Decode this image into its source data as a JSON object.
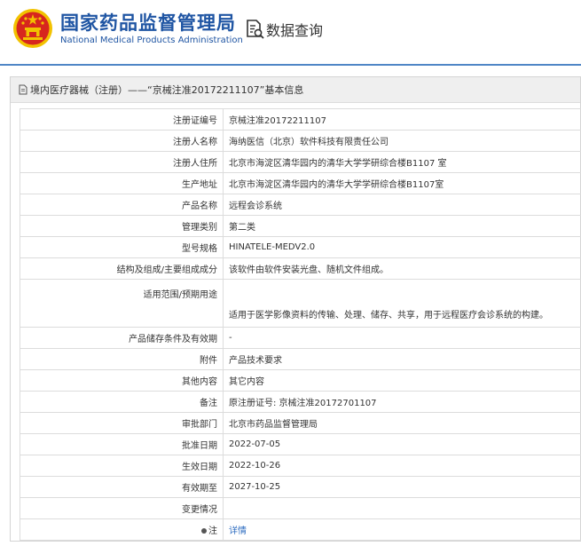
{
  "header": {
    "org_name_cn": "国家药品监督管理局",
    "org_name_en": "National Medical Products Administration",
    "query_title": "数据查询"
  },
  "panel": {
    "title": "境内医疗器械（注册）——“京械注准20172211107”基本信息"
  },
  "rows": [
    {
      "label": "注册证编号",
      "value": "京械注准20172211107"
    },
    {
      "label": "注册人名称",
      "value": "海纳医信（北京）软件科技有限责任公司"
    },
    {
      "label": "注册人住所",
      "value": "北京市海淀区清华园内的清华大学学研综合楼B1107 室"
    },
    {
      "label": "生产地址",
      "value": "北京市海淀区清华园内的清华大学学研综合楼B1107室"
    },
    {
      "label": "产品名称",
      "value": "远程会诊系统"
    },
    {
      "label": "管理类别",
      "value": "第二类"
    },
    {
      "label": "型号规格",
      "value": "HINATELE-MEDV2.0"
    },
    {
      "label": "结构及组成/主要组成成分",
      "value": "该软件由软件安装光盘、随机文件组成。"
    },
    {
      "label": "适用范围/预期用途",
      "value": "适用于医学影像资料的传输、处理、储存、共享，用于远程医疗会诊系统的构建。"
    },
    {
      "label": "产品储存条件及有效期",
      "value": "-"
    },
    {
      "label": "附件",
      "value": "产品技术要求"
    },
    {
      "label": "其他内容",
      "value": "其它内容"
    },
    {
      "label": "备注",
      "value": "原注册证号: 京械注准20172701107"
    },
    {
      "label": "审批部门",
      "value": "北京市药品监督管理局"
    },
    {
      "label": "批准日期",
      "value": "2022-07-05"
    },
    {
      "label": "生效日期",
      "value": "2022-10-26"
    },
    {
      "label": "有效期至",
      "value": "2027-10-25"
    },
    {
      "label": "变更情况",
      "value": ""
    },
    {
      "label": "注",
      "value": "详情"
    }
  ],
  "colors": {
    "brand_blue": "#1f55a3",
    "emblem_red": "#d7261e",
    "emblem_gold": "#f2c200",
    "link_blue": "#2d6cc0"
  },
  "icons": {
    "emblem": "national-emblem-icon",
    "query": "document-search-icon",
    "panel": "document-icon",
    "note": "dot-icon"
  }
}
